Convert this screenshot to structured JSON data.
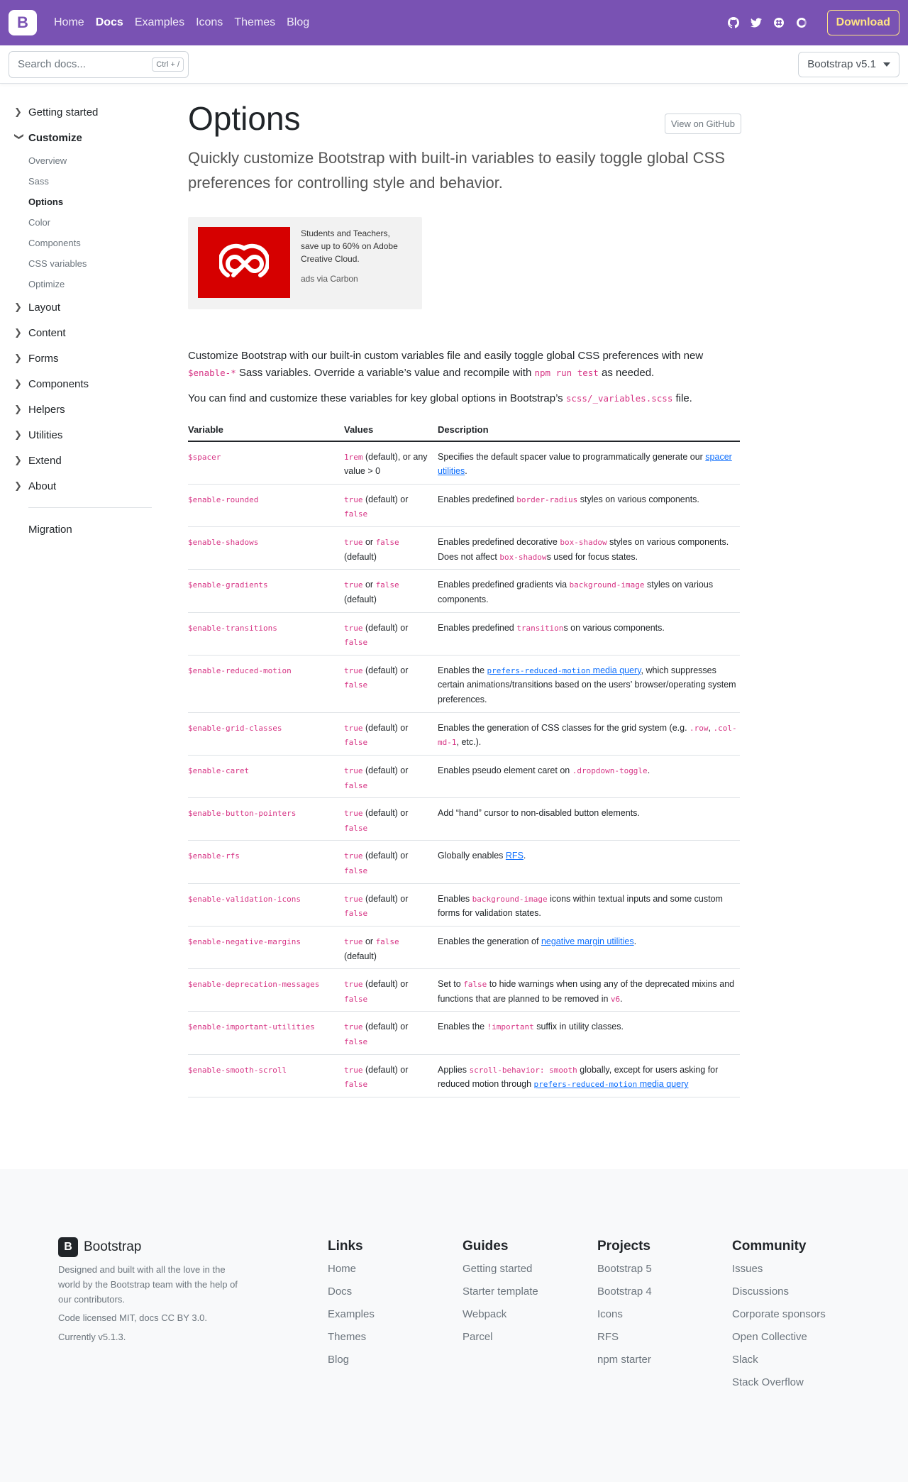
{
  "navbar": {
    "brand": "B",
    "links": [
      "Home",
      "Docs",
      "Examples",
      "Icons",
      "Themes",
      "Blog"
    ],
    "download": "Download",
    "accent": "#7952b3",
    "icons": [
      "github-icon",
      "twitter-icon",
      "slack-icon",
      "opencollective-icon"
    ]
  },
  "subnav": {
    "search_placeholder": "Search docs...",
    "shortcut": "Ctrl + /",
    "version": "Bootstrap v5.1"
  },
  "sidebar": {
    "groups_before": [
      "Getting started"
    ],
    "active_group": "Customize",
    "sub_items": [
      "Overview",
      "Sass",
      "Options",
      "Color",
      "Components",
      "CSS variables",
      "Optimize"
    ],
    "active_sub": "Options",
    "groups_after": [
      "Layout",
      "Content",
      "Forms",
      "Components",
      "Helpers",
      "Utilities",
      "Extend",
      "About"
    ],
    "migration": "Migration"
  },
  "main": {
    "title": "Options",
    "github_button": "View on GitHub",
    "lead": "Quickly customize Bootstrap with built-in variables to easily toggle global CSS preferences for controlling style and behavior.",
    "ad": {
      "text": "Students and Teachers, save up to 60% on Adobe Creative Cloud.",
      "via": "ads via Carbon"
    },
    "p1": {
      "a": "Customize Bootstrap with our built-in custom variables file and easily toggle global CSS preferences with new ",
      "code1": "$enable-*",
      "b": " Sass variables. Override a variable’s value and recompile with ",
      "code2": "npm run test",
      "c": " as needed."
    },
    "p2": {
      "a": "You can find and customize these variables for key global options in Bootstrap’s ",
      "code": "scss/_variables.scss",
      "b": " file."
    },
    "table": {
      "headers": [
        "Variable",
        "Values",
        "Description"
      ],
      "rows": [
        {
          "var": "$spacer",
          "vals": [
            [
              "c",
              "1rem"
            ],
            [
              "t",
              " (default), or any value > 0"
            ]
          ],
          "desc": [
            [
              "t",
              "Specifies the default spacer value to programmatically generate our "
            ],
            [
              "l",
              "spacer utilities"
            ],
            [
              "t",
              "."
            ]
          ]
        },
        {
          "var": "$enable-rounded",
          "vals": [
            [
              "c",
              "true"
            ],
            [
              "t",
              " (default) or "
            ],
            [
              "c",
              "false"
            ]
          ],
          "desc": [
            [
              "t",
              "Enables predefined "
            ],
            [
              "c",
              "border-radius"
            ],
            [
              "t",
              " styles on various components."
            ]
          ]
        },
        {
          "var": "$enable-shadows",
          "vals": [
            [
              "c",
              "true"
            ],
            [
              "t",
              " or "
            ],
            [
              "c",
              "false"
            ],
            [
              "t",
              " (default)"
            ]
          ],
          "desc": [
            [
              "t",
              "Enables predefined decorative "
            ],
            [
              "c",
              "box-shadow"
            ],
            [
              "t",
              " styles on various components. Does not affect "
            ],
            [
              "c",
              "box-shadow"
            ],
            [
              "t",
              "s used for focus states."
            ]
          ]
        },
        {
          "var": "$enable-gradients",
          "vals": [
            [
              "c",
              "true"
            ],
            [
              "t",
              " or "
            ],
            [
              "c",
              "false"
            ],
            [
              "t",
              " (default)"
            ]
          ],
          "desc": [
            [
              "t",
              "Enables predefined gradients via "
            ],
            [
              "c",
              "background-image"
            ],
            [
              "t",
              " styles on various components."
            ]
          ]
        },
        {
          "var": "$enable-transitions",
          "vals": [
            [
              "c",
              "true"
            ],
            [
              "t",
              " (default) or "
            ],
            [
              "c",
              "false"
            ]
          ],
          "desc": [
            [
              "t",
              "Enables predefined "
            ],
            [
              "c",
              "transition"
            ],
            [
              "t",
              "s on various components."
            ]
          ]
        },
        {
          "var": "$enable-reduced-motion",
          "vals": [
            [
              "c",
              "true"
            ],
            [
              "t",
              " (default) or "
            ],
            [
              "c",
              "false"
            ]
          ],
          "desc": [
            [
              "t",
              "Enables the "
            ],
            [
              "lc",
              "prefers-reduced-motion"
            ],
            [
              "l",
              " media query"
            ],
            [
              "t",
              ", which suppresses certain animations/transitions based on the users’ browser/operating system preferences."
            ]
          ]
        },
        {
          "var": "$enable-grid-classes",
          "vals": [
            [
              "c",
              "true"
            ],
            [
              "t",
              " (default) or "
            ],
            [
              "c",
              "false"
            ]
          ],
          "desc": [
            [
              "t",
              "Enables the generation of CSS classes for the grid system (e.g. "
            ],
            [
              "c",
              ".row"
            ],
            [
              "t",
              ", "
            ],
            [
              "c",
              ".col-md-1"
            ],
            [
              "t",
              ", etc.)."
            ]
          ]
        },
        {
          "var": "$enable-caret",
          "vals": [
            [
              "c",
              "true"
            ],
            [
              "t",
              " (default) or "
            ],
            [
              "c",
              "false"
            ]
          ],
          "desc": [
            [
              "t",
              "Enables pseudo element caret on "
            ],
            [
              "c",
              ".dropdown-toggle"
            ],
            [
              "t",
              "."
            ]
          ]
        },
        {
          "var": "$enable-button-pointers",
          "vals": [
            [
              "c",
              "true"
            ],
            [
              "t",
              " (default) or "
            ],
            [
              "c",
              "false"
            ]
          ],
          "desc": [
            [
              "t",
              "Add “hand” cursor to non-disabled button elements."
            ]
          ]
        },
        {
          "var": "$enable-rfs",
          "vals": [
            [
              "c",
              "true"
            ],
            [
              "t",
              " (default) or "
            ],
            [
              "c",
              "false"
            ]
          ],
          "desc": [
            [
              "t",
              "Globally enables "
            ],
            [
              "l",
              "RFS"
            ],
            [
              "t",
              "."
            ]
          ]
        },
        {
          "var": "$enable-validation-icons",
          "vals": [
            [
              "c",
              "true"
            ],
            [
              "t",
              " (default) or "
            ],
            [
              "c",
              "false"
            ]
          ],
          "desc": [
            [
              "t",
              "Enables "
            ],
            [
              "c",
              "background-image"
            ],
            [
              "t",
              " icons within textual inputs and some custom forms for validation states."
            ]
          ]
        },
        {
          "var": "$enable-negative-margins",
          "vals": [
            [
              "c",
              "true"
            ],
            [
              "t",
              " or "
            ],
            [
              "c",
              "false"
            ],
            [
              "t",
              " (default)"
            ]
          ],
          "desc": [
            [
              "t",
              "Enables the generation of "
            ],
            [
              "l",
              "negative margin utilities"
            ],
            [
              "t",
              "."
            ]
          ]
        },
        {
          "var": "$enable-deprecation-messages",
          "vals": [
            [
              "c",
              "true"
            ],
            [
              "t",
              " (default) or "
            ],
            [
              "c",
              "false"
            ]
          ],
          "desc": [
            [
              "t",
              "Set to "
            ],
            [
              "c",
              "false"
            ],
            [
              "t",
              " to hide warnings when using any of the deprecated mixins and functions that are planned to be removed in "
            ],
            [
              "c",
              "v6"
            ],
            [
              "t",
              "."
            ]
          ]
        },
        {
          "var": "$enable-important-utilities",
          "vals": [
            [
              "c",
              "true"
            ],
            [
              "t",
              " (default) or "
            ],
            [
              "c",
              "false"
            ]
          ],
          "desc": [
            [
              "t",
              "Enables the "
            ],
            [
              "c",
              "!important"
            ],
            [
              "t",
              " suffix in utility classes."
            ]
          ]
        },
        {
          "var": "$enable-smooth-scroll",
          "vals": [
            [
              "c",
              "true"
            ],
            [
              "t",
              " (default) or "
            ],
            [
              "c",
              "false"
            ]
          ],
          "desc": [
            [
              "t",
              "Applies "
            ],
            [
              "c",
              "scroll-behavior: smooth"
            ],
            [
              "t",
              " globally, except for users asking for reduced motion through "
            ],
            [
              "lc",
              "prefers-reduced-motion"
            ],
            [
              "l",
              " media query"
            ]
          ]
        }
      ]
    }
  },
  "footer": {
    "brand": "Bootstrap",
    "desc": "Designed and built with all the love in the world by the Bootstrap team with the help of our contributors.",
    "license": "Code licensed MIT, docs CC BY 3.0.",
    "version": "Currently v5.1.3.",
    "columns": [
      {
        "title": "Links",
        "items": [
          "Home",
          "Docs",
          "Examples",
          "Themes",
          "Blog"
        ]
      },
      {
        "title": "Guides",
        "items": [
          "Getting started",
          "Starter template",
          "Webpack",
          "Parcel"
        ]
      },
      {
        "title": "Projects",
        "items": [
          "Bootstrap 5",
          "Bootstrap 4",
          "Icons",
          "RFS",
          "npm starter"
        ]
      },
      {
        "title": "Community",
        "items": [
          "Issues",
          "Discussions",
          "Corporate sponsors",
          "Open Collective",
          "Slack",
          "Stack Overflow"
        ]
      }
    ]
  }
}
